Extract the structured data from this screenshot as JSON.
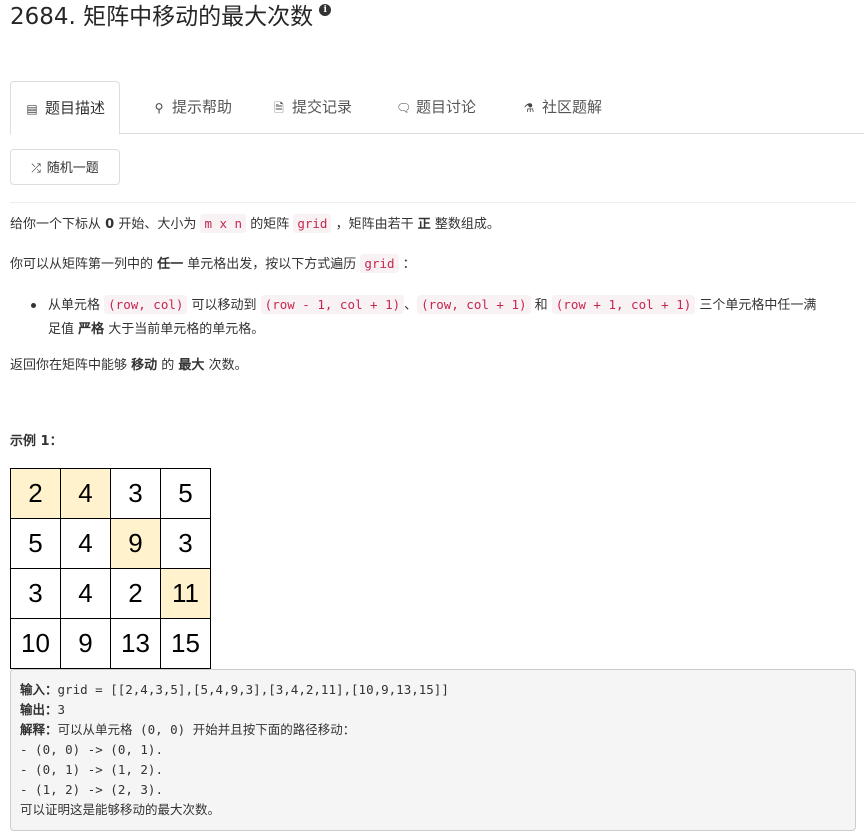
{
  "title": "2684. 矩阵中移动的最大次数",
  "tabs": [
    {
      "label": "题目描述",
      "icon": "list-icon"
    },
    {
      "label": "提示帮助",
      "icon": "lightbulb-icon"
    },
    {
      "label": "提交记录",
      "icon": "code-file-icon"
    },
    {
      "label": "题目讨论",
      "icon": "comments-icon"
    },
    {
      "label": "社区题解",
      "icon": "flask-icon"
    }
  ],
  "random_button": "随机一题",
  "description": {
    "p1": [
      "给你一个下标从 ",
      "0",
      " 开始、大小为 ",
      "m x n",
      " 的矩阵 ",
      "grid",
      " ，矩阵由若干 ",
      "正",
      " 整数组成。"
    ],
    "p2": [
      "你可以从矩阵第一列中的 ",
      "任一",
      " 单元格出发，按以下方式遍历 ",
      "grid",
      " ："
    ],
    "bullet": [
      "从单元格 ",
      "(row, col)",
      " 可以移动到 ",
      "(row - 1, col + 1)",
      "、",
      "(row, col + 1)",
      " 和 ",
      "(row + 1, col + 1)",
      " 三个单元格中任一满",
      "足值 ",
      "严格",
      " 大于当前单元格的单元格。"
    ],
    "p3": [
      "返回你在矩阵中能够 ",
      "移动",
      " 的 ",
      "最大",
      " 次数。"
    ]
  },
  "example_title": "示例 1：",
  "grid": [
    [
      2,
      4,
      3,
      5
    ],
    [
      5,
      4,
      9,
      3
    ],
    [
      3,
      4,
      2,
      11
    ],
    [
      10,
      9,
      13,
      15
    ]
  ],
  "highlighted": [
    "0-0",
    "0-1",
    "1-2",
    "2-3"
  ],
  "example": {
    "input_label": "输入：",
    "input_value": "grid = [[2,4,3,5],[5,4,9,3],[3,4,2,11],[10,9,13,15]]",
    "output_label": "输出：",
    "output_value": "3",
    "explain_label": "解释：",
    "explain_value": "可以从单元格 (0, 0) 开始并且按下面的路径移动：",
    "steps": [
      "- (0, 0) -> (0, 1).",
      "- (0, 1) -> (1, 2).",
      "- (1, 2) -> (2, 3)."
    ],
    "conclusion": "可以证明这是能够移动的最大次数。"
  },
  "colors": {
    "highlight": "#fff2cc",
    "code_text": "#c7254e",
    "code_bg": "#f9f2f4"
  }
}
